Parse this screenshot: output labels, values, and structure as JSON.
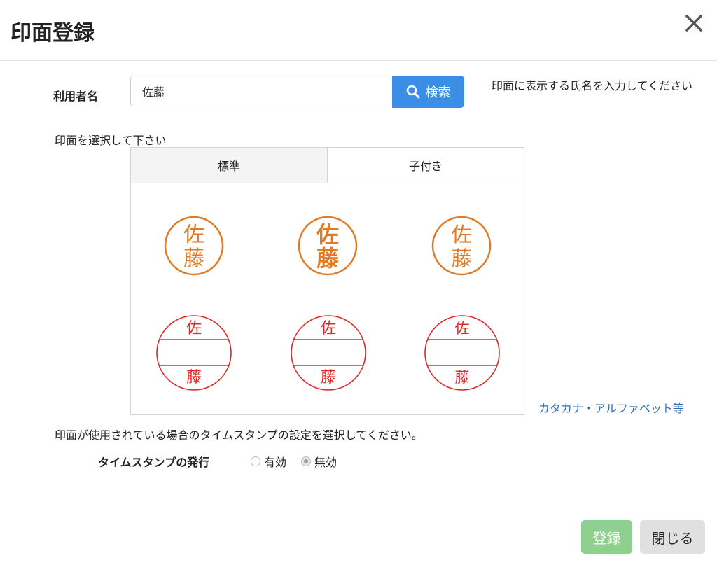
{
  "header": {
    "title": "印面登録",
    "close_icon": "close-icon"
  },
  "user_field": {
    "label": "利用者名",
    "value": "佐藤"
  },
  "search": {
    "label": "検索",
    "icon": "search-icon"
  },
  "hint": {
    "text": "印面に表示する氏名を入力してください"
  },
  "select_prompt": "印面を選択して下さい",
  "tabs": [
    {
      "label": "標準",
      "active": true
    },
    {
      "label": "子付き",
      "active": false
    }
  ],
  "stamps": {
    "row1": {
      "color": "#e07a24",
      "char1": "佐",
      "char2": "藤"
    },
    "row2": {
      "color": "#e02828",
      "char1": "佐",
      "char2": "藤"
    }
  },
  "other_chars_link": "カタカナ・アルファベット等",
  "timestamp": {
    "prompt": "印面が使用されている場合のタイムスタンプの設定を選択してください。",
    "label": "タイムスタンプの発行",
    "options": [
      {
        "label": "有効",
        "checked": false
      },
      {
        "label": "無効",
        "checked": true
      }
    ]
  },
  "footer": {
    "register_label": "登録",
    "close_label": "閉じる"
  },
  "colors": {
    "primary": "#3a8ee6",
    "register": "#8fcf8f",
    "link": "#2f6fb0"
  }
}
